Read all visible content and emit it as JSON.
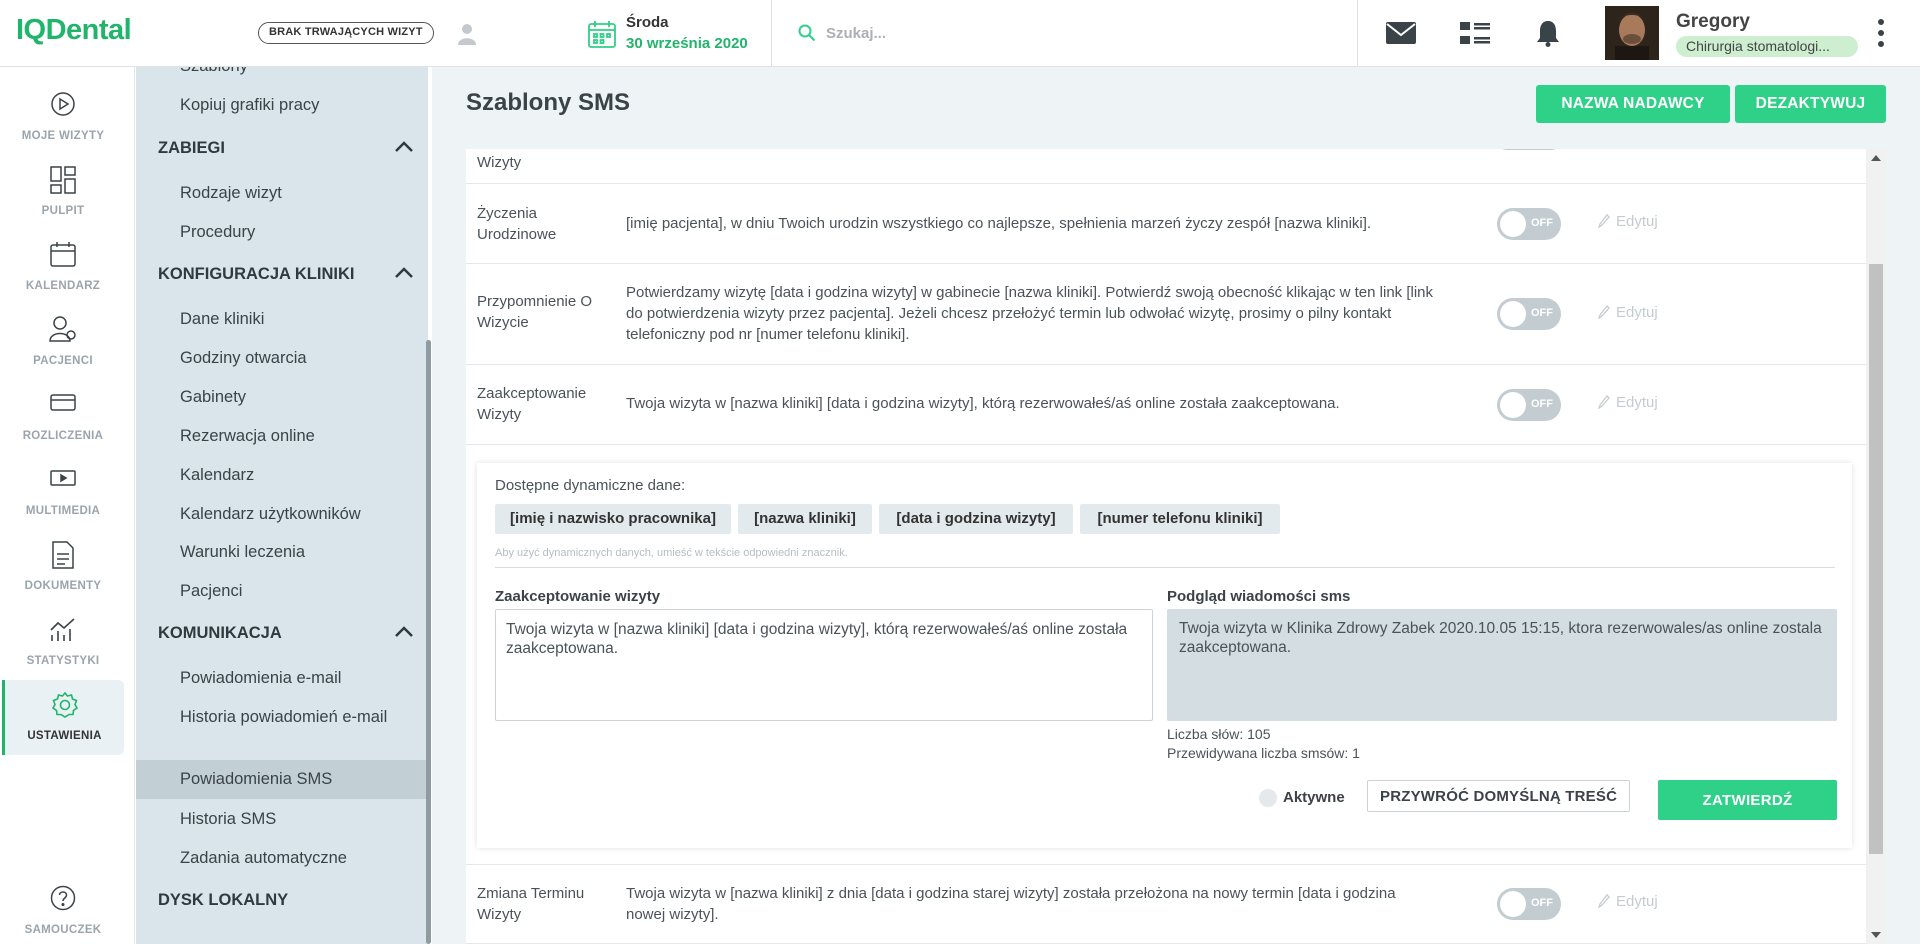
{
  "header": {
    "logo": "IQDental",
    "visit_badge": "BRAK TRWAJĄCYCH WIZYT",
    "date_day": "Środa",
    "date_full": "30 września 2020",
    "search_placeholder": "Szukaj...",
    "user_name": "Gregory",
    "user_role": "Chirurgia stomatologi..."
  },
  "leftnav": [
    {
      "label": "MOJE WIZYTY",
      "icon": "play-circle-icon"
    },
    {
      "label": "PULPIT",
      "icon": "dashboard-icon"
    },
    {
      "label": "KALENDARZ",
      "icon": "calendar-icon"
    },
    {
      "label": "PACJENCI",
      "icon": "patients-icon"
    },
    {
      "label": "ROZLICZENIA",
      "icon": "card-icon"
    },
    {
      "label": "MULTIMEDIA",
      "icon": "media-icon"
    },
    {
      "label": "DOKUMENTY",
      "icon": "document-icon"
    },
    {
      "label": "STATYSTYKI",
      "icon": "stats-icon"
    },
    {
      "label": "USTAWIENIA",
      "icon": "gear-icon"
    },
    {
      "label": "SAMOUCZEK",
      "icon": "help-icon"
    }
  ],
  "submenu": {
    "top_items": [
      "Szablony",
      "Kopiuj grafiki pracy"
    ],
    "zabiegi": {
      "title": "ZABIEGI",
      "items": [
        "Rodzaje wizyt",
        "Procedury"
      ]
    },
    "konfiguracja": {
      "title": "KONFIGURACJA KLINIKI",
      "items": [
        "Dane kliniki",
        "Godziny otwarcia",
        "Gabinety",
        "Rezerwacja online",
        "Kalendarz",
        "Kalendarz użytkowników",
        "Warunki leczenia",
        "Pacjenci"
      ]
    },
    "komunikacja": {
      "title": "KOMUNIKACJA",
      "items": [
        "Powiadomienia e-mail",
        "Historia powiadomień e-mail",
        "Powiadomienia SMS",
        "Historia SMS",
        "Zadania automatyczne"
      ]
    },
    "dysk": {
      "title": "DYSK LOKALNY"
    }
  },
  "main": {
    "title": "Szablony SMS",
    "btn_sender": "NAZWA NADAWCY",
    "btn_deactivate": "DEZAKTYWUJ",
    "partial_row_name": "Wizyty",
    "toggle_off": "OFF",
    "edit_label": "Edytuj",
    "rows": [
      {
        "name": "Życzenia Urodzinowe",
        "text": "[imię pacjenta], w dniu Twoich urodzin wszystkiego co najlepsze, spełnienia marzeń życzy zespół [nazwa kliniki]."
      },
      {
        "name": "Przypomnienie O Wizycie",
        "text": "Potwierdzamy wizytę [data i godzina wizyty] w gabinecie [nazwa kliniki]. Potwierdź swoją obecność klikając w ten link [link do potwierdzenia wizyty przez pacjenta]. Jeżeli chcesz przełożyć termin lub odwołać wizytę, prosimy o pilny kontakt telefoniczny pod nr [numer telefonu kliniki]."
      },
      {
        "name": "Zaakceptowanie Wizyty",
        "text": "Twoja wizyta w [nazwa kliniki] [data i godzina wizyty], którą rezerwowałeś/aś online została zaakceptowana."
      },
      {
        "name": "Zmiana Terminu Wizyty",
        "text": "Twoja wizyta w [nazwa kliniki] z dnia [data i godzina starej wizyty] została przełożona na nowy termin [data i godzina nowej wizyty]."
      }
    ],
    "editor": {
      "dynamic_label": "Dostępne dynamiczne dane:",
      "chips": [
        "[imię i nazwisko pracownika]",
        "[nazwa kliniki]",
        "[data i godzina wizyty]",
        "[numer telefonu kliniki]"
      ],
      "hint": "Aby użyć dynamicznych danych, umieść w tekście odpowiedni znacznik.",
      "template_label": "Zaakceptowanie wizyty",
      "template_value": "Twoja wizyta w [nazwa kliniki] [data i godzina wizyty], którą rezerwowałeś/aś online została zaakceptowana.",
      "preview_label": "Podgląd wiadomości sms",
      "preview_text": "Twoja wizyta w Klinika Zdrowy Zabek 2020.10.05 15:15, ktora rezerwowales/as online zostala zaakceptowana.",
      "word_count": "Liczba słów: 105",
      "sms_count": "Przewidywana liczba smsów: 1",
      "active_label": "Aktywne",
      "restore_button": "PRZYWRÓĆ DOMYŚLNĄ TREŚĆ",
      "confirm_button": "ZATWIERDŹ"
    }
  },
  "colors": {
    "brand": "#20b56b",
    "button": "#2fd087",
    "submenu_bg": "#d9e5ea",
    "main_bg": "#eef3f5"
  }
}
